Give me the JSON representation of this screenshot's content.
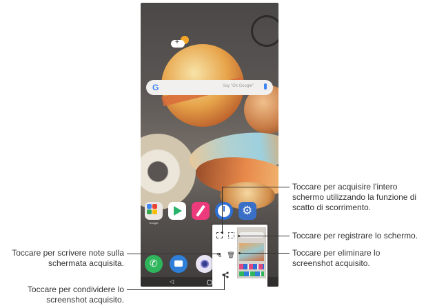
{
  "phone": {
    "search_hint": "Say \"Ok Google\"",
    "apps": [
      {
        "name": "Google"
      },
      {
        "name": "Play Store"
      },
      {
        "name": "QuickMemo+"
      },
      {
        "name": "Clock"
      },
      {
        "name": "Settings"
      }
    ],
    "dock": [
      "Phone",
      "Messages",
      "Camera"
    ]
  },
  "popup": {
    "buttons": [
      "scroll-capture-icon",
      "record-screen-icon",
      "write-note-icon",
      "delete-icon",
      "share-icon"
    ]
  },
  "callouts": {
    "scroll_capture": "Toccare per acquisire l'intero schermo utilizzando la funzione di scatto di scorrimento.",
    "record": "Toccare per registrare lo schermo.",
    "delete": "Toccare per eliminare lo screenshot acquisito.",
    "write": "Toccare per scrivere note sulla schermata acquisita.",
    "share": "Toccare per condividere lo screenshot acquisito."
  }
}
